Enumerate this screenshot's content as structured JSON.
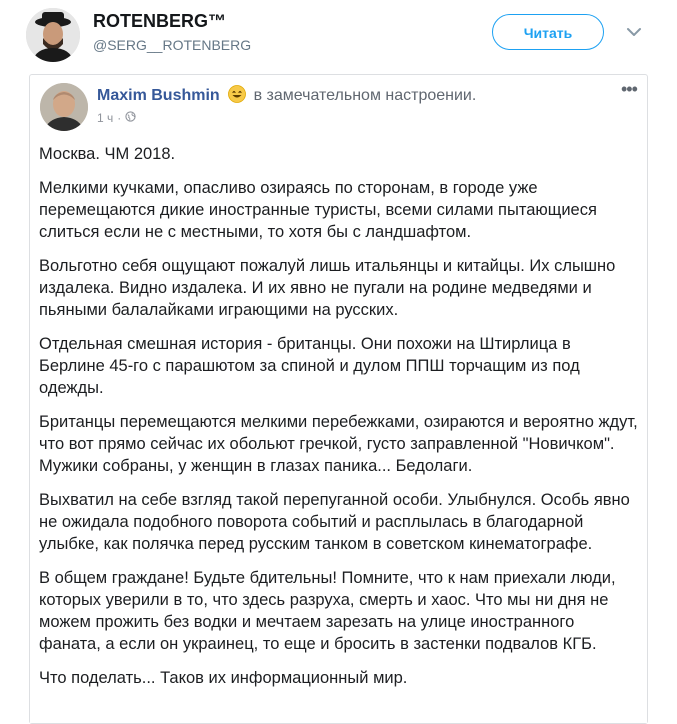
{
  "tweet": {
    "display_name": "ROTENBERG™",
    "handle": "@SERG__ROTENBERG",
    "follow_label": "Читать",
    "caret_icon": "chevron-down-icon"
  },
  "fb_post": {
    "author": "Maxim Bushmin",
    "feeling_emoji": "smiling-face-icon",
    "feeling": "в замечательном настроении.",
    "time": "1 ч",
    "separator": "·",
    "privacy_icon": "globe-icon",
    "more_label": "•••",
    "paragraphs": [
      "Москва. ЧМ 2018.",
      "Мелкими кучками, опасливо озираясь по сторонам, в городе уже перемещаются дикие иностранные туристы, всеми силами пытающиеся слиться если не с местными, то хотя бы с ландшафтом.",
      "Вольготно себя ощущают пожалуй лишь итальянцы и китайцы. Их слышно издалека. Видно издалека. И их явно не пугали на родине медведями и пьяными балалайками играющими на русских.",
      "Отдельная смешная история - британцы. Они похожи на Штирлица в Берлине 45-го с парашютом за спиной и дулом ППШ торчащим из под одежды.",
      "Британцы перемещаются мелкими перебежками, озираются и вероятно ждут, что вот прямо сейчас их обольют гречкой, густо заправленной \"Новичком\". Мужики собраны, у женщин в глазах паника... Бедолаги.",
      "Выхватил на себе взгляд такой перепуганной особи. Улыбнулся. Особь явно не ожидала подобного поворота событий и расплылась в благодарной улыбке, как полячка перед русским танком в советском кинематографе.",
      "В общем граждане! Будьте бдительны! Помните, что к нам приехали люди, которых уверили в то, что здесь разруха, смерть и хаос. Что мы ни дня не можем прожить без водки и мечтаем зарезать на улице иностранного фаната, а если он украинец, то еще и бросить в застенки подвалов КГБ.",
      "Что поделать... Таков их информационный мир."
    ]
  },
  "colors": {
    "twitter_blue": "#1da1f2",
    "fb_link": "#365899",
    "text": "#1c1e21",
    "muted": "#90949c"
  }
}
